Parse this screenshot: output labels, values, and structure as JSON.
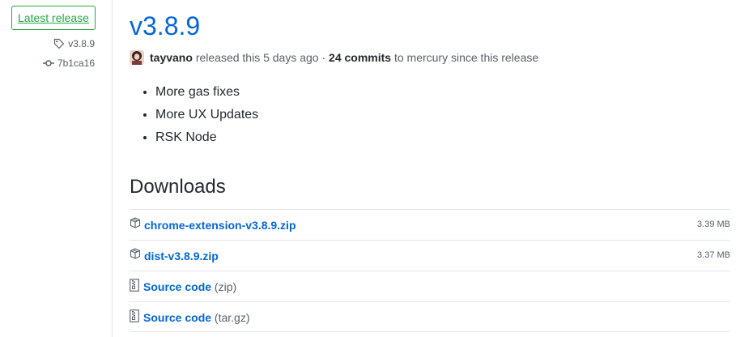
{
  "sidebar": {
    "badge_label": "Latest release",
    "tag": "v3.8.9",
    "commit": "7b1ca16"
  },
  "release": {
    "title": "v3.8.9",
    "author": "tayvano",
    "released_text": "released this 5 days ago",
    "separator": "·",
    "commits": "24 commits",
    "commits_suffix": "to mercury since this release"
  },
  "notes": [
    "More gas fixes",
    "More UX Updates",
    "RSK Node"
  ],
  "downloads": {
    "title": "Downloads",
    "assets": [
      {
        "name": "chrome-extension-v3.8.9.zip",
        "size": "3.39 MB",
        "icon": "package-icon"
      },
      {
        "name": "dist-v3.8.9.zip",
        "size": "3.37 MB",
        "icon": "package-icon"
      }
    ],
    "source": [
      {
        "label": "Source code",
        "format": "(zip)",
        "icon": "file-zip-icon"
      },
      {
        "label": "Source code",
        "format": "(tar.gz)",
        "icon": "file-zip-icon"
      }
    ]
  },
  "colors": {
    "link": "#0366d6",
    "badge": "#28a745",
    "muted": "#586069",
    "border": "#e1e4e8"
  }
}
